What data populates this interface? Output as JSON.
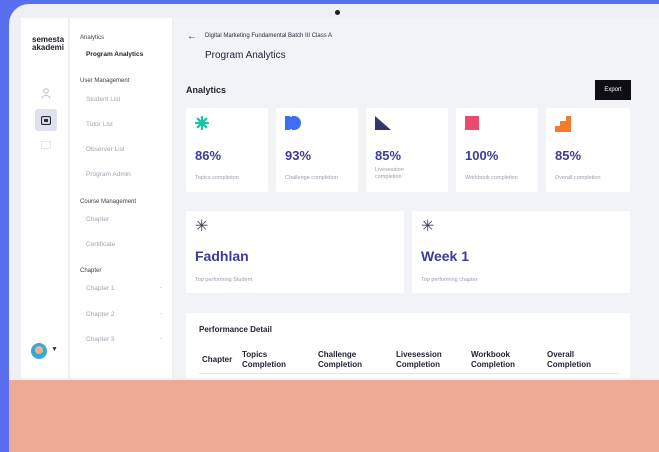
{
  "app": {
    "logo_line1": "semesta",
    "logo_line2": "akademi"
  },
  "menu": {
    "analytics_section": "Analytics",
    "program_analytics": "Program Analytics",
    "user_section": "User Management",
    "student_list": "Student List",
    "tutor_list": "Tutor List",
    "observer_list": "Observer List",
    "program_admin": "Program Admin",
    "course_section": "Course Management",
    "chapter": "Chapter",
    "certificate": "Certificate",
    "chapter_section": "Chapter",
    "chapter_items": [
      "Chapter 1",
      "Chapter 2",
      "Chapter 3"
    ],
    "chevron": "-"
  },
  "header": {
    "breadcrumb": "Digital Marketing Fundamental Batch III Class A",
    "title": "Program Analytics"
  },
  "analytics": {
    "section_title": "Analytics",
    "export_label": "Export",
    "stats": [
      {
        "value": "86%",
        "label": "Topics completion",
        "icon": "asterisk-icon",
        "color": "#18c3a0"
      },
      {
        "value": "93%",
        "label": "Challenge completion",
        "icon": "double-d-icon",
        "color": "#3e6df2"
      },
      {
        "value": "85%",
        "label": "Livesession completion",
        "icon": "triangle-icon",
        "color": "#33366e"
      },
      {
        "value": "100%",
        "label": "Workbook completion",
        "icon": "square-icon",
        "color": "#ea4a6e"
      },
      {
        "value": "85%",
        "label": "Overall completion",
        "icon": "stairs-icon",
        "color": "#f47a2c"
      }
    ],
    "top_student": {
      "value": "Fadhlan",
      "label": "Top performing Student"
    },
    "top_chapter": {
      "value": "Week 1",
      "label": "Top performing chapter"
    }
  },
  "performance": {
    "title": "Performance Detail",
    "columns": [
      "Chapter",
      "Topics Completion",
      "Challenge Completion",
      "Livesession Completion",
      "Workbook Completion",
      "Overall Completion"
    ]
  }
}
